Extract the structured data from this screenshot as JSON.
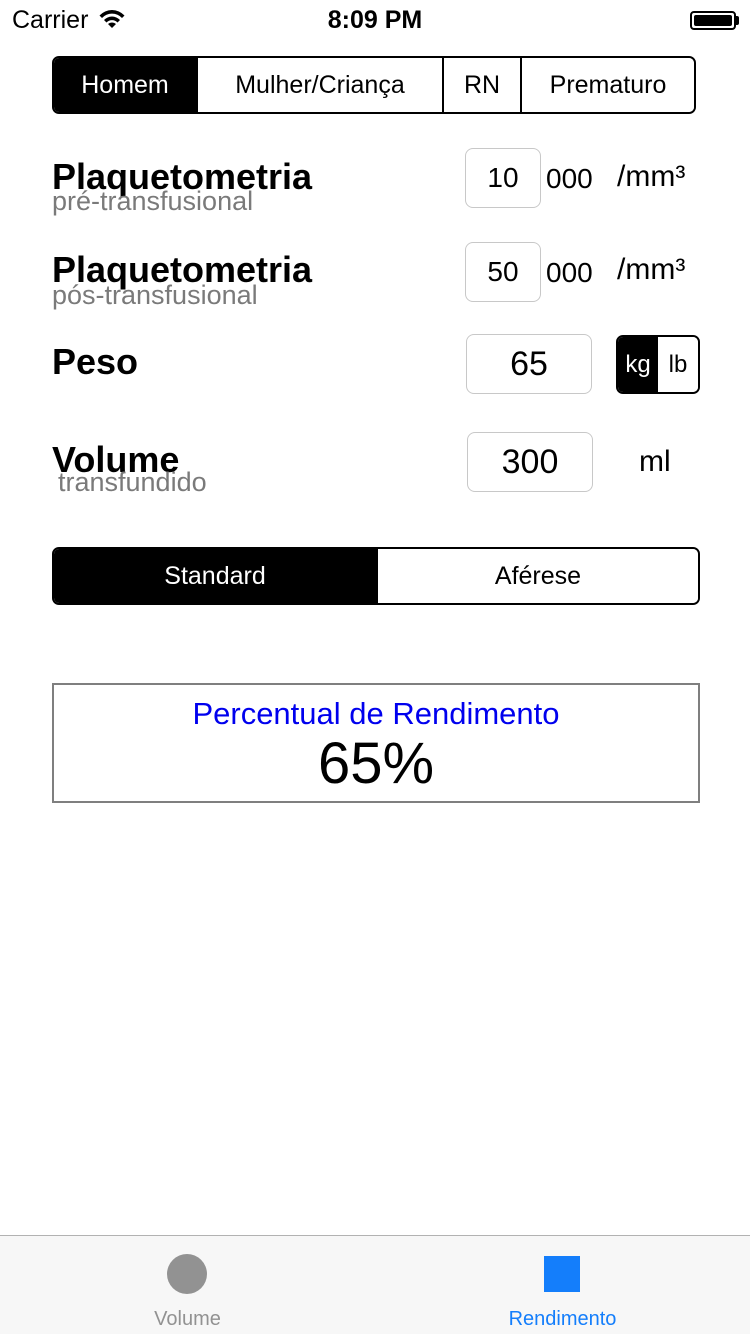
{
  "status_bar": {
    "carrier": "Carrier",
    "time": "8:09 PM",
    "wifi_icon": "wifi-icon",
    "battery_icon": "battery-icon"
  },
  "patient_segment": {
    "items": [
      "Homem",
      "Mulher/Criança",
      "RN",
      "Prematuro"
    ],
    "selected": "Homem"
  },
  "pre": {
    "label": "Plaquetometria",
    "sublabel": "pré-transfusional",
    "value": "10",
    "suffix": "000",
    "unit": "/mm³"
  },
  "post": {
    "label": "Plaquetometria",
    "sublabel": "pós-transfusional",
    "value": "50",
    "suffix": "000",
    "unit": "/mm³"
  },
  "weight": {
    "label": "Peso",
    "value": "65",
    "units": [
      "kg",
      "lb"
    ],
    "selected_unit": "kg"
  },
  "volume": {
    "label": "Volume",
    "sublabel": "transfundido",
    "value": "300",
    "unit": "ml"
  },
  "type_segment": {
    "items": [
      "Standard",
      "Aférese"
    ],
    "selected": "Standard"
  },
  "result": {
    "title": "Percentual de Rendimento",
    "value": "65%"
  },
  "tabbar": {
    "tabs": [
      {
        "label": "Volume",
        "icon": "circle-icon",
        "active": false
      },
      {
        "label": "Rendimento",
        "icon": "square-icon",
        "active": true
      }
    ]
  },
  "colors": {
    "accent": "#147efb",
    "result_title": "#0000ee",
    "inactive_tab": "#929292"
  }
}
